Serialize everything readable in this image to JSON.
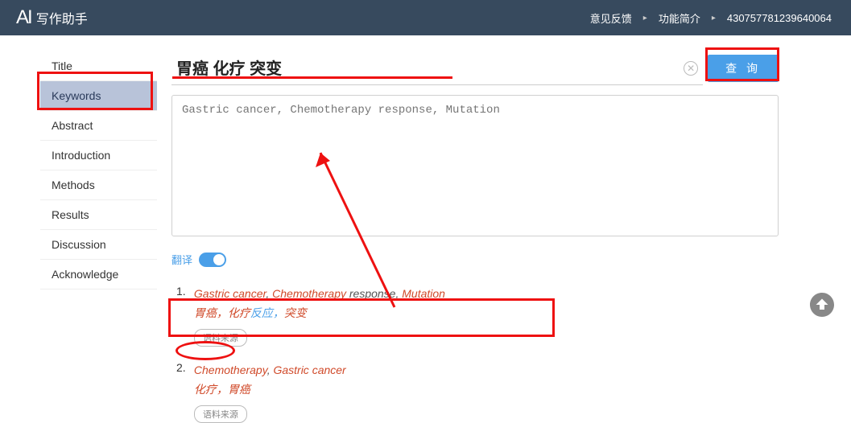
{
  "header": {
    "logo_ai": "AI",
    "logo_text": "写作助手",
    "links": [
      "意见反馈",
      "功能简介",
      "430757781239640064"
    ]
  },
  "sidebar": {
    "items": [
      {
        "label": "Title"
      },
      {
        "label": "Keywords"
      },
      {
        "label": "Abstract"
      },
      {
        "label": "Introduction"
      },
      {
        "label": "Methods"
      },
      {
        "label": "Results"
      },
      {
        "label": "Discussion"
      },
      {
        "label": "Acknowledge"
      }
    ],
    "active_index": 1
  },
  "main": {
    "search_value": "胃癌 化疗 突变",
    "query_button": "查 询",
    "textarea_placeholder": "Gastric cancer, Chemotherapy response, Mutation",
    "translate_label": "翻译",
    "translate_on": true
  },
  "results": [
    {
      "num": "1.",
      "line1_parts": [
        {
          "text": "Gastric cancer",
          "hl": true
        },
        {
          "text": ", ",
          "hl": false
        },
        {
          "text": "Chemotherapy",
          "hl": true
        },
        {
          "text": " response, ",
          "hl": false
        },
        {
          "text": "Mutation",
          "hl": true
        }
      ],
      "line2_html": "胃癌，化疗<span class='plain'>反应，</span>突变",
      "source_label": "语料来源"
    },
    {
      "num": "2.",
      "line1_parts": [
        {
          "text": "Chemotherapy",
          "hl": true
        },
        {
          "text": ", ",
          "hl": false
        },
        {
          "text": "Gastric cancer",
          "hl": true
        }
      ],
      "line2_html": "化疗，胃癌",
      "source_label": "语料来源"
    }
  ]
}
